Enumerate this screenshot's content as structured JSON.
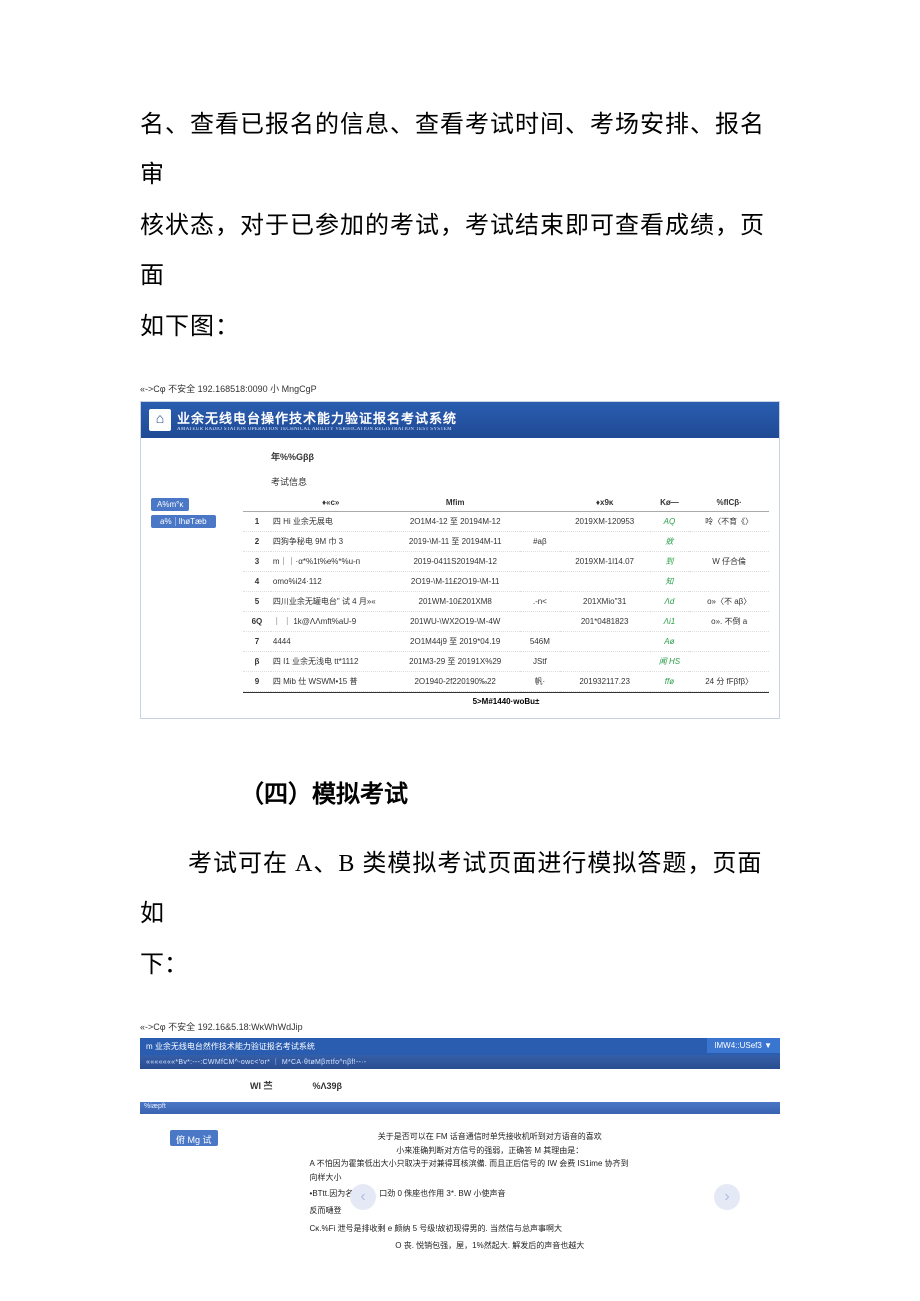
{
  "intro": {
    "line1": "名、查看已报名的信息、查看考试时间、考场安排、报名审",
    "line2": "核状态，对于已参加的考试，考试结束即可查看成绩，页面",
    "line3": "如下图："
  },
  "url1": "«->Cφ 不安全 192.168518:0090 小 MngCgP",
  "app1": {
    "logo_glyph": "⌂",
    "title": "业余无线电台操作技术能力验证报名考试系统",
    "subtitle": "AMATEUR RADIO STATION OPERATION TECHNICAL ABILITY VERIFICATION REGISTRATION TEST SYSTEM",
    "row1": "年%%Gββ",
    "section": "考试信息",
    "side_tag1": "A%m°κ",
    "side_tag2a": "a%",
    "side_tag2b": "IhøTæb",
    "headers": {
      "idx": "",
      "name": "♦«c»",
      "date": "Mfim",
      "field4": "",
      "code": "♦x9κ",
      "status": "Kø—",
      "result": "%flCβ·"
    },
    "rows": [
      {
        "idx": "1",
        "name": "四 Hi 业余无展电",
        "date": "2O1M4-12 至 20194M-12",
        "f4": "",
        "code": "2019XM-120953",
        "status": "AQ",
        "result": "呤〈不育《〉"
      },
      {
        "idx": "2",
        "name": "四狗争秘电 9M 巾 3",
        "date": "2019-\\M-11 至 20194M-11",
        "f4": "#aβ",
        "code": "",
        "status": "敚",
        "result": ""
      },
      {
        "idx": "3",
        "name": "m｜｜·α*%1t%e%*%u-п",
        "date": "2019-0411S20194M-12",
        "f4": "",
        "code": "2019XM-1l14.07",
        "status": "到",
        "result": "W 仔合倫"
      },
      {
        "idx": "4",
        "name": "omo%i24·112",
        "date": "2O19-\\M-11£2O19-\\M-11",
        "f4": "",
        "code": "",
        "status": "知",
        "result": ""
      },
      {
        "idx": "5",
        "name": "四川业余无罐电台\" 试 4 月»«",
        "date": "201WM-10£201XM8",
        "f4": ".-n<",
        "code": "201XMio\"31",
        "status": "Λd",
        "result": "o»〈不 aβ〉"
      },
      {
        "idx": "6Q",
        "name": "｜ ｜ 1k@ΛΛmft%aU-9",
        "date": "201WU-\\WX2O19-\\M-4W",
        "f4": "",
        "code": "201*0481823",
        "status": "Λi1",
        "result": "o». 不倒 a"
      },
      {
        "idx": "7",
        "name": "4444",
        "date": "2O1M44j9 至 2019*04.19",
        "f4": "546M",
        "code": "",
        "status": "Aø",
        "result": ""
      },
      {
        "idx": "β",
        "name": "四 I1 业余无浅电 tt*1112",
        "date": "201M3-29 至 20191X%29",
        "f4": "JStf",
        "code": "",
        "status": "闻 HS",
        "result": ""
      },
      {
        "idx": "9",
        "name": "四 Mib 仕 WSWM•15 普",
        "date": "2O1940-2f220190‰22",
        "f4": "帆·",
        "code": "201932117.23",
        "status": "ffø",
        "result": "24 分 fFβfβ〉"
      }
    ],
    "pager": "5>M#1440·woBu±"
  },
  "heading4": "（四）模拟考试",
  "para2a": "考试可在 A、B 类模拟考试页面进行模拟答题，页面如",
  "para2b": "下：",
  "url2": "«->Cφ 不安全 192.16&5.18:WκWhWdJip",
  "app2": {
    "topbar": "m 业余无线电台然作技术能力验证报名考试系统",
    "userbox": "lMW4::USef3 ▼",
    "tabs": "«««««««*Bv*:---:CWMfCM^-owc<'or* ｜ M*CA·θtøMβπtfo^nβf!--·-",
    "menu_a": "WI 苎",
    "menu_b": "%Λ39β",
    "bar_left": "%iæpft",
    "left_btn": "俯 Mg 试",
    "q1": "关于是否可以在 FM 话音通信时单凭接收机听到对方语音的喜欢",
    "q2": "小来准确判断对方信号的强弱，正确答 M 其理由是：",
    "q3": "A 不怕因为霍策低出大小只取决于对兼得耳核滨備. 而且正后信号的 IW 会费 IS1ime 协齐到",
    "q3b": "向样大小",
    "optB": "•BTtt.因为名 effiS，口劲 0 侏座也作用 3*.          BW 小使声音",
    "optB2": "反而嗵登",
    "optC": "Cκ.%Fi 泄号是排收剩 e 颇纳 5 号级!故初现得男的. 当然信与总声事啊大",
    "optD": "O 丧. 悦销包强，屋，1%然起大. 解发后的声音也越大",
    "arrow_left": "‹",
    "arrow_right": "›"
  }
}
